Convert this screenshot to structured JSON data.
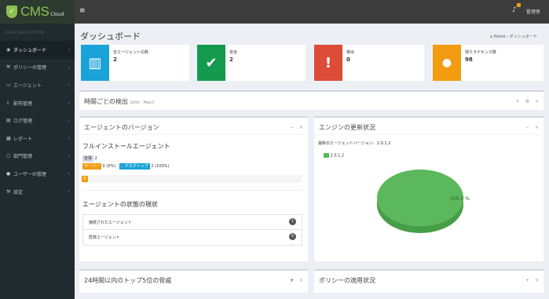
{
  "header": {
    "brand": "CMS",
    "brand_suffix": "Cloud",
    "logo_glyph": "✓",
    "admin_label": "管理者",
    "menu_icon": "hamburger-icon",
    "bell_icon": "bell-icon"
  },
  "sidebar": {
    "nav_header": "MAIN NAVIGATION",
    "items": [
      {
        "label": "ダッシュボード",
        "icon": "dashboard-icon",
        "glyph": "◉",
        "active": true
      },
      {
        "label": "ポリシーの管理",
        "icon": "wrench-icon",
        "glyph": "⚒"
      },
      {
        "label": "エージェント",
        "icon": "desktop-icon",
        "glyph": "▭"
      },
      {
        "label": "配布管理",
        "icon": "download-icon",
        "glyph": "⇩"
      },
      {
        "label": "ログ管理",
        "icon": "log-icon",
        "glyph": "▤"
      },
      {
        "label": "レポート",
        "icon": "report-icon",
        "glyph": "▦"
      },
      {
        "label": "部門管理",
        "icon": "folder-icon",
        "glyph": "▢"
      },
      {
        "label": "ユーザーの管理",
        "icon": "user-icon",
        "glyph": "●"
      },
      {
        "label": "設定",
        "icon": "wrench-icon",
        "glyph": "⚒"
      }
    ],
    "chevron": "‹"
  },
  "page": {
    "title": "ダッシュボード",
    "breadcrumb_home": "Home",
    "breadcrumb_sep": "›",
    "breadcrumb_current": "ダッシュボード",
    "home_glyph": "⌂"
  },
  "stats": [
    {
      "label": "全エージェントの数",
      "value": "2",
      "color": "#1aa3d8",
      "icon": "tablet-icon",
      "glyph": "▥"
    },
    {
      "label": "安全",
      "value": "2",
      "color": "#149a4d",
      "icon": "check-icon",
      "glyph": "✔"
    },
    {
      "label": "検出",
      "value": "0",
      "color": "#dd4b39",
      "icon": "exclamation-icon",
      "glyph": "!"
    },
    {
      "label": "残りライセンス数",
      "value": "98",
      "color": "#f39c12",
      "icon": "users-icon",
      "glyph": "●"
    }
  ],
  "panels": {
    "hourly": {
      "title": "時間ごとの検出",
      "subtitle": "(Unit : Hour)",
      "tools": [
        "+",
        "⚙",
        "×"
      ]
    },
    "versions": {
      "title": "エージェントのバージョン",
      "tools": [
        "−",
        "×"
      ],
      "full_install": "フルインストールエージェント",
      "all_label": "全体",
      "all_value": "2",
      "server_label": "サーバー",
      "server_value": "0 (0%)",
      "desktop_label": "、デスクトップ",
      "desktop_value": "2 (100%)",
      "progress_label": "0",
      "progress_value": 0,
      "status_title": "エージェントの状態の現状",
      "status_items": [
        {
          "label": "接続されたエージェント",
          "count": "1"
        },
        {
          "label": "危険エージェント",
          "count": "0"
        }
      ]
    },
    "engine": {
      "title": "エンジンの更新状況",
      "tools": [
        "−",
        "×"
      ],
      "latest": "最新のエージェントバージョン：2.0.1.2",
      "legend": "2.0.1.2",
      "pie_label": "100.0 %"
    },
    "top5": {
      "title": "24時間以内のトップ5位の脅威",
      "tools": [
        "+",
        "×"
      ]
    },
    "policy": {
      "title": "ポリシーの適用状況",
      "tools": [
        "+",
        "×"
      ]
    }
  },
  "chart_data": {
    "type": "pie",
    "categories": [
      "2.0.1.2"
    ],
    "values": [
      100
    ],
    "title": "",
    "labels": [
      "100.0 %"
    ]
  }
}
